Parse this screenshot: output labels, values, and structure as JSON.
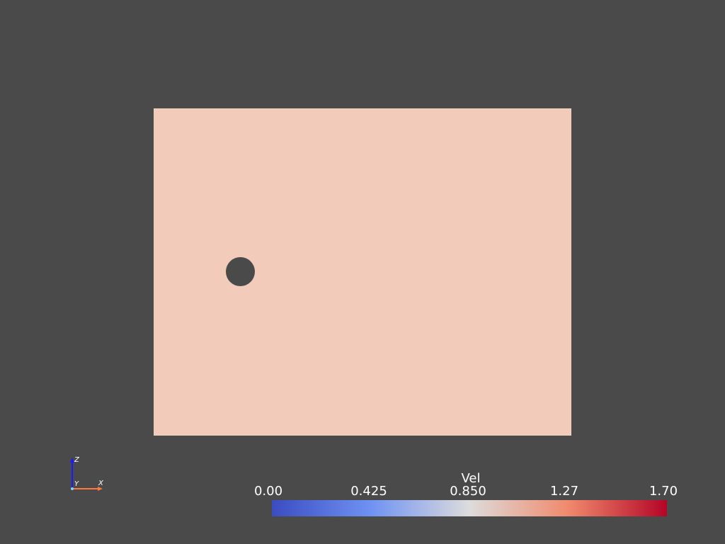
{
  "scene": {
    "background_color": "#4a4a4a",
    "domain_color": "#f2cbbb",
    "obstacle_color": "#4a4a4a"
  },
  "orientation_axes": {
    "z_label": "Z",
    "y_label": "Y",
    "x_label": "X",
    "z_color": "#1a1aff",
    "x_color": "#ff7a3a"
  },
  "colorbar": {
    "title": "Vel",
    "ticks": [
      "0.00",
      "0.425",
      "0.850",
      "1.27",
      "1.70"
    ],
    "colormap": "coolwarm",
    "range": [
      0.0,
      1.7
    ],
    "low_color": "#3b4cc0",
    "mid_color": "#dddcdc",
    "high_color": "#b40426"
  }
}
